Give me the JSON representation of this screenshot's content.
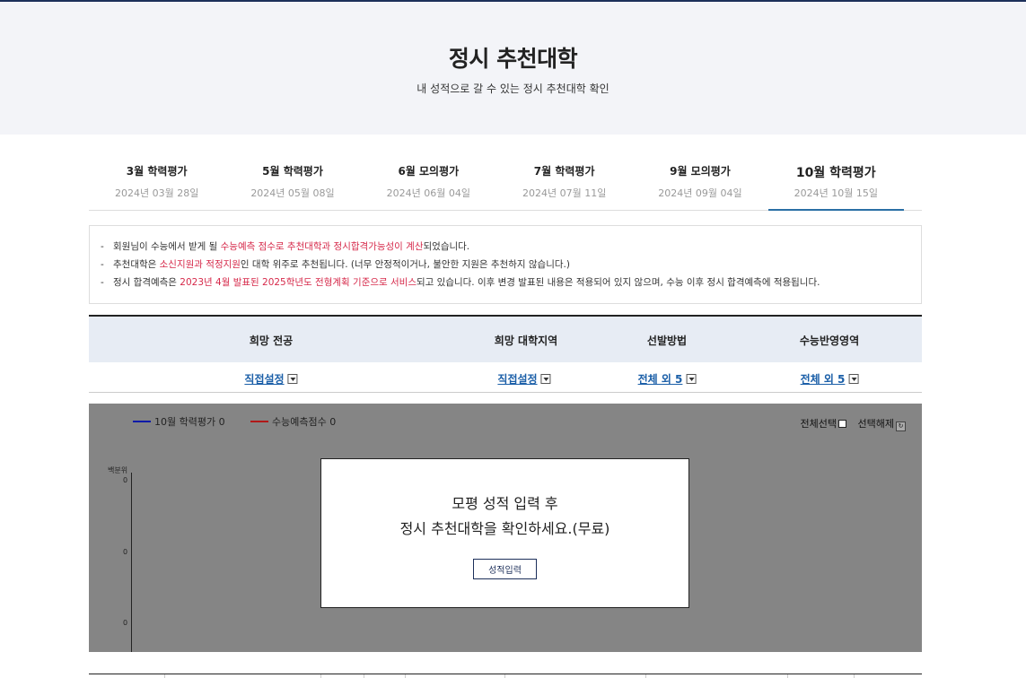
{
  "hero": {
    "title": "정시 추천대학",
    "subtitle": "내 성적으로 갈 수 있는 정시 추천대학 확인"
  },
  "tabs": [
    {
      "name": "3월 학력평가",
      "date": "2024년 03월 28일",
      "active": false
    },
    {
      "name": "5월 학력평가",
      "date": "2024년 05월 08일",
      "active": false
    },
    {
      "name": "6월 모의평가",
      "date": "2024년 06월 04일",
      "active": false
    },
    {
      "name": "7월 학력평가",
      "date": "2024년 07월 11일",
      "active": false
    },
    {
      "name": "9월 모의평가",
      "date": "2024년 09월 04일",
      "active": false
    },
    {
      "name": "10월 학력평가",
      "date": "2024년 10월 15일",
      "active": true
    }
  ],
  "notice": {
    "dash": "-",
    "line1": {
      "a": "회원님이 수능에서 받게 될 ",
      "hl": "수능예측 점수로 추천대학과 정시합격가능성이 계산",
      "b": "되었습니다."
    },
    "line2": {
      "a": "추천대학은 ",
      "hl": "소신지원과 적정지원",
      "b": "인 대학 위주로 추천됩니다. (너무 안정적이거나, 불안한 지원은 추천하지 않습니다.)"
    },
    "line3": {
      "a": "정시 합격예측은 ",
      "hl": "2023년 4월 발표된 2025학년도 전형계획 기준으로 서비스",
      "b": "되고 있습니다. 이후 변경 발표된 내용은 적용되어 있지 않으며, 수능 이후 정시 합격예측에 적용됩니다."
    }
  },
  "filters": {
    "headers": [
      "희망 전공",
      "희망 대학지역",
      "선발방법",
      "수능반영영역"
    ],
    "values": [
      "직접설정",
      "직접설정",
      "전체 외 5",
      "전체 외 5"
    ]
  },
  "chart": {
    "legend1": "10월 학력평가 0",
    "legend2": "수능예측점수 0",
    "legend1_color": "#0a1aa8",
    "legend2_color": "#b01818",
    "select_all": "전체선택",
    "deselect": "선택해제",
    "y_unit": "백분위",
    "y_ticks": [
      "0",
      "0",
      "0"
    ]
  },
  "modal": {
    "line1": "모평 성적 입력 후",
    "line2": "정시 추천대학을 확인하세요.(무료)",
    "button": "성적입력"
  }
}
